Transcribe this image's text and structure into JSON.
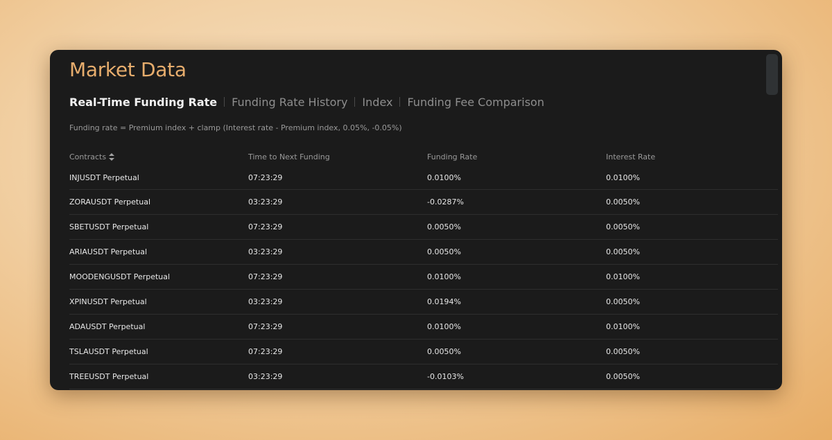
{
  "page": {
    "title": "Market Data",
    "formula": "Funding rate = Premium index + clamp (Interest rate - Premium index, 0.05%, -0.05%)"
  },
  "tabs": [
    {
      "label": "Real-Time Funding Rate",
      "active": true
    },
    {
      "label": "Funding Rate History",
      "active": false
    },
    {
      "label": "Index",
      "active": false
    },
    {
      "label": "Funding Fee Comparison",
      "active": false
    }
  ],
  "table": {
    "columns": [
      "Contracts",
      "Time to Next Funding",
      "Funding Rate",
      "Interest Rate"
    ],
    "sort_icon": "sort-icon",
    "rows": [
      [
        "INJUSDT Perpetual",
        "07:23:29",
        "0.0100%",
        "0.0100%"
      ],
      [
        "ZORAUSDT Perpetual",
        "03:23:29",
        "-0.0287%",
        "0.0050%"
      ],
      [
        "SBETUSDT Perpetual",
        "07:23:29",
        "0.0050%",
        "0.0050%"
      ],
      [
        "ARIAUSDT Perpetual",
        "03:23:29",
        "0.0050%",
        "0.0050%"
      ],
      [
        "MOODENGUSDT Perpetual",
        "07:23:29",
        "0.0100%",
        "0.0100%"
      ],
      [
        "XPINUSDT Perpetual",
        "03:23:29",
        "0.0194%",
        "0.0050%"
      ],
      [
        "ADAUSDT Perpetual",
        "07:23:29",
        "0.0100%",
        "0.0100%"
      ],
      [
        "TSLAUSDT Perpetual",
        "07:23:29",
        "0.0050%",
        "0.0050%"
      ],
      [
        "TREEUSDT Perpetual",
        "03:23:29",
        "-0.0103%",
        "0.0050%"
      ]
    ]
  },
  "colors": {
    "accent": "#e7ad6d",
    "panel_bg": "#1b1b1b",
    "text_primary": "#e8e8e8",
    "text_muted": "#9a9a9a"
  }
}
